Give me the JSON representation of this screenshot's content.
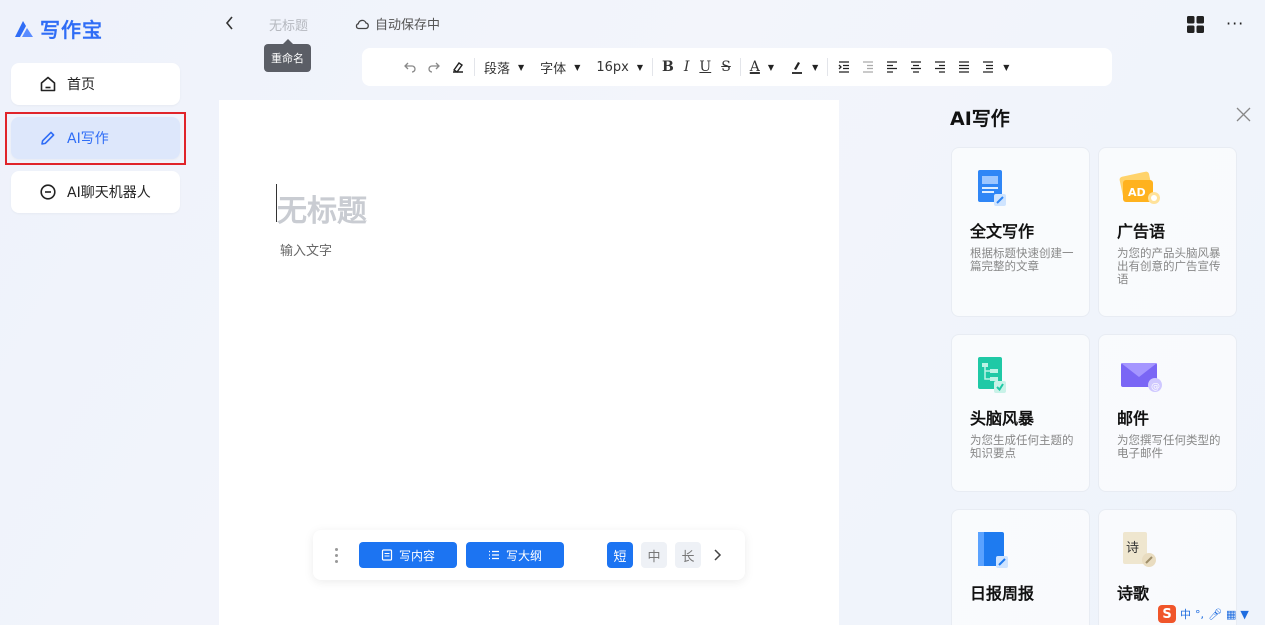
{
  "app": {
    "logo_text": "写作宝",
    "brand_color": "#2f6df6"
  },
  "sidebar": {
    "items": [
      {
        "label": "首页",
        "icon": "home-icon"
      },
      {
        "label": "AI写作",
        "icon": "pencil-icon",
        "active": true
      },
      {
        "label": "AI聊天机器人",
        "icon": "chat-icon"
      }
    ]
  },
  "topbar": {
    "doc_title": "无标题",
    "tooltip": "重命名",
    "autosave": "自动保存中"
  },
  "toolbar": {
    "paragraph": "段落",
    "font": "字体",
    "font_size": "16px",
    "bold": "B",
    "italic": "I",
    "underline": "U",
    "strike": "S",
    "font_color": "A"
  },
  "editor": {
    "title_placeholder": "无标题",
    "body_placeholder": "输入文字"
  },
  "bottom_bar": {
    "write_content": "写内容",
    "write_outline": "写大纲",
    "lengths": [
      "短",
      "中",
      "长"
    ],
    "selected_length": "短"
  },
  "ai_panel": {
    "title": "AI写作",
    "cards": [
      {
        "title": "全文写作",
        "desc": "根据标题快速创建一篇完整的文章",
        "icon": "document-write-icon"
      },
      {
        "title": "广告语",
        "desc": "为您的产品头脑风暴出有创意的广告宣传语",
        "icon": "ad-icon"
      },
      {
        "title": "头脑风暴",
        "desc": "为您生成任何主题的知识要点",
        "icon": "mindmap-icon"
      },
      {
        "title": "邮件",
        "desc": "为您撰写任何类型的电子邮件",
        "icon": "email-icon"
      },
      {
        "title": "日报周报",
        "desc": "",
        "icon": "report-book-icon"
      },
      {
        "title": "诗歌",
        "desc": "",
        "icon": "poem-icon"
      }
    ]
  },
  "ime": {
    "logo": "S",
    "mode": "中"
  }
}
